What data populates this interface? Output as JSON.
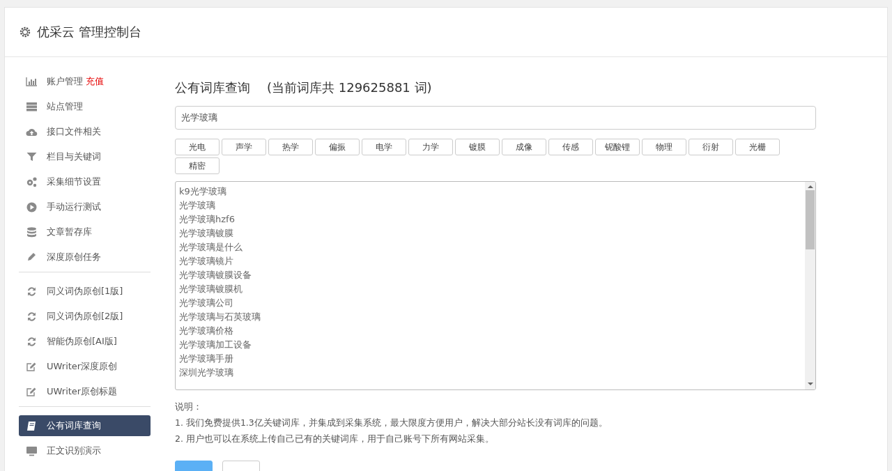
{
  "header": {
    "title": "优采云 管理控制台"
  },
  "sidebar": {
    "groups": [
      {
        "items": [
          {
            "label": "账户管理",
            "badge": "充值",
            "selected": false
          },
          {
            "label": "站点管理",
            "selected": false
          },
          {
            "label": "接口文件相关",
            "selected": false
          },
          {
            "label": "栏目与关键词",
            "selected": false
          },
          {
            "label": "采集细节设置",
            "selected": false
          },
          {
            "label": "手动运行测试",
            "selected": false
          },
          {
            "label": "文章暂存库",
            "selected": false
          },
          {
            "label": "深度原创任务",
            "selected": false
          }
        ]
      },
      {
        "items": [
          {
            "label": "同义词伪原创[1版]",
            "selected": false
          },
          {
            "label": "同义词伪原创[2版]",
            "selected": false
          },
          {
            "label": "智能伪原创[AI版]",
            "selected": false
          },
          {
            "label": "UWriter深度原创",
            "selected": false
          },
          {
            "label": "UWriter原创标题",
            "selected": false
          }
        ]
      },
      {
        "items": [
          {
            "label": "公有词库查询",
            "selected": true
          },
          {
            "label": "正文识别演示",
            "selected": false
          }
        ]
      }
    ]
  },
  "main": {
    "title": "公有词库查询",
    "count_note": "(当前词库共 129625881 词)",
    "search": {
      "value": "光学玻璃"
    },
    "tags": [
      "光电",
      "声学",
      "热学",
      "偏振",
      "电学",
      "力学",
      "镀膜",
      "成像",
      "传感",
      "铌酸锂",
      "物理",
      "衍射",
      "光栅",
      "精密"
    ],
    "results": [
      "k9光学玻璃",
      "光学玻璃",
      "光学玻璃hzf6",
      "光学玻璃镀膜",
      "光学玻璃是什么",
      "光学玻璃镜片",
      "光学玻璃镀膜设备",
      "光学玻璃镀膜机",
      "光学玻璃公司",
      "光学玻璃与石英玻璃",
      "光学玻璃价格",
      "光学玻璃加工设备",
      "光学玻璃手册",
      "深圳光学玻璃"
    ],
    "notes_title": "说明：",
    "notes": [
      "1. 我们免费提供1.3亿关键词库，并集成到采集系统，最大限度方便用户，解决大部分站长没有词库的问题。",
      "2. 用户也可以在系统上传自己已有的关键词库，用于自己账号下所有网站采集。"
    ],
    "buttons": [
      {
        "kind": "primary"
      },
      {
        "kind": "default"
      }
    ]
  }
}
